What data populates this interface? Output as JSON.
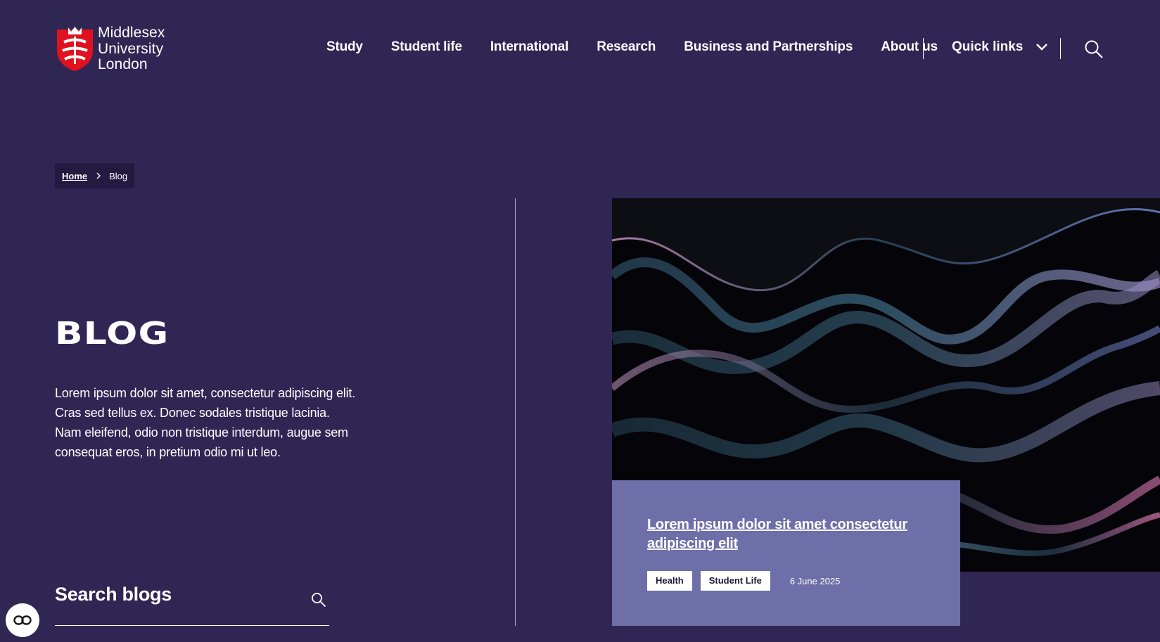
{
  "header": {
    "logo": {
      "line1": "Middlesex",
      "line2": "University",
      "line3": "London",
      "shield_color": "#e1121f"
    },
    "nav": [
      "Study",
      "Student life",
      "International",
      "Research",
      "Business and Partnerships",
      "About us"
    ],
    "quick_links_label": "Quick links",
    "search_icon": "search-icon"
  },
  "breadcrumb": {
    "home": "Home",
    "current": "Blog"
  },
  "main": {
    "title": "BLOG",
    "intro": "Lorem ipsum dolor sit amet, consectetur adipiscing elit. Cras sed tellus ex. Donec sodales tristique lacinia. Nam eleifend, odio non tristique interdum, augue sem consequat eros, in pretium odio mi ut leo.",
    "search_label": "Search blogs"
  },
  "featured": {
    "title": "Lorem ipsum dolor sit amet consectetur adipiscing elit",
    "tags": [
      "Health",
      "Student Life"
    ],
    "date": "6 June 2025"
  },
  "colors": {
    "background": "#302654",
    "card": "#6e6ea8",
    "breadcrumb_bg": "#221a40"
  },
  "accessibility_button_icon": "accessibility-icon"
}
